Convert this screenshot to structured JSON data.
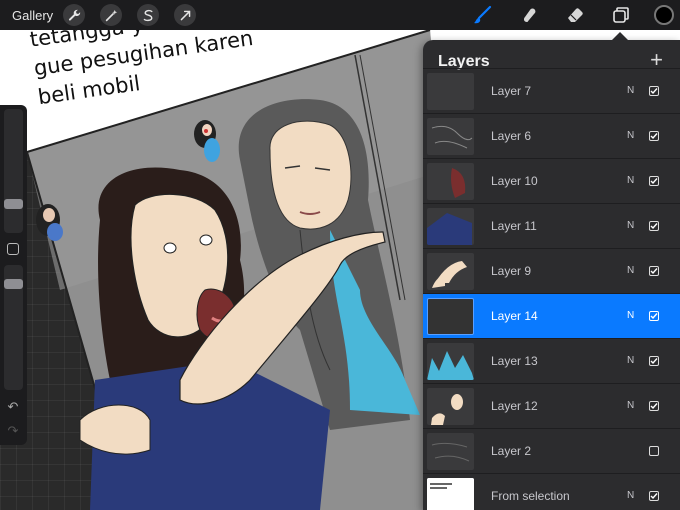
{
  "toolbar": {
    "gallery_label": "Gallery",
    "left_tools": [
      {
        "name": "wrench-icon"
      },
      {
        "name": "magic-wand-icon"
      },
      {
        "name": "selection-s-icon"
      },
      {
        "name": "transform-arrow-icon"
      }
    ],
    "right_tools": [
      {
        "name": "brush-icon",
        "active": true
      },
      {
        "name": "smudge-icon",
        "active": false
      },
      {
        "name": "eraser-icon",
        "active": false
      },
      {
        "name": "layers-icon",
        "active": false
      }
    ],
    "current_color": "#000000",
    "accent_color": "#0a7aff"
  },
  "canvas": {
    "caption_lines": [
      "tetangga y",
      "gue pesugihan karen",
      "beli mobil"
    ]
  },
  "sidebar": {
    "icons": [
      {
        "name": "undo-icon"
      },
      {
        "name": "redo-icon"
      }
    ]
  },
  "layers_panel": {
    "title": "Layers",
    "add_label": "+",
    "layers": [
      {
        "name": "Layer 7",
        "blend": "N",
        "visible": true,
        "selected": false
      },
      {
        "name": "Layer 6",
        "blend": "N",
        "visible": true,
        "selected": false
      },
      {
        "name": "Layer 10",
        "blend": "N",
        "visible": true,
        "selected": false
      },
      {
        "name": "Layer 11",
        "blend": "N",
        "visible": true,
        "selected": false
      },
      {
        "name": "Layer 9",
        "blend": "N",
        "visible": true,
        "selected": false
      },
      {
        "name": "Layer 14",
        "blend": "N",
        "visible": true,
        "selected": true
      },
      {
        "name": "Layer 13",
        "blend": "N",
        "visible": true,
        "selected": false
      },
      {
        "name": "Layer 12",
        "blend": "N",
        "visible": true,
        "selected": false
      },
      {
        "name": "Layer 2",
        "blend": "N",
        "visible": false,
        "selected": false
      },
      {
        "name": "From selection",
        "blend": "N",
        "visible": true,
        "selected": false
      }
    ]
  }
}
